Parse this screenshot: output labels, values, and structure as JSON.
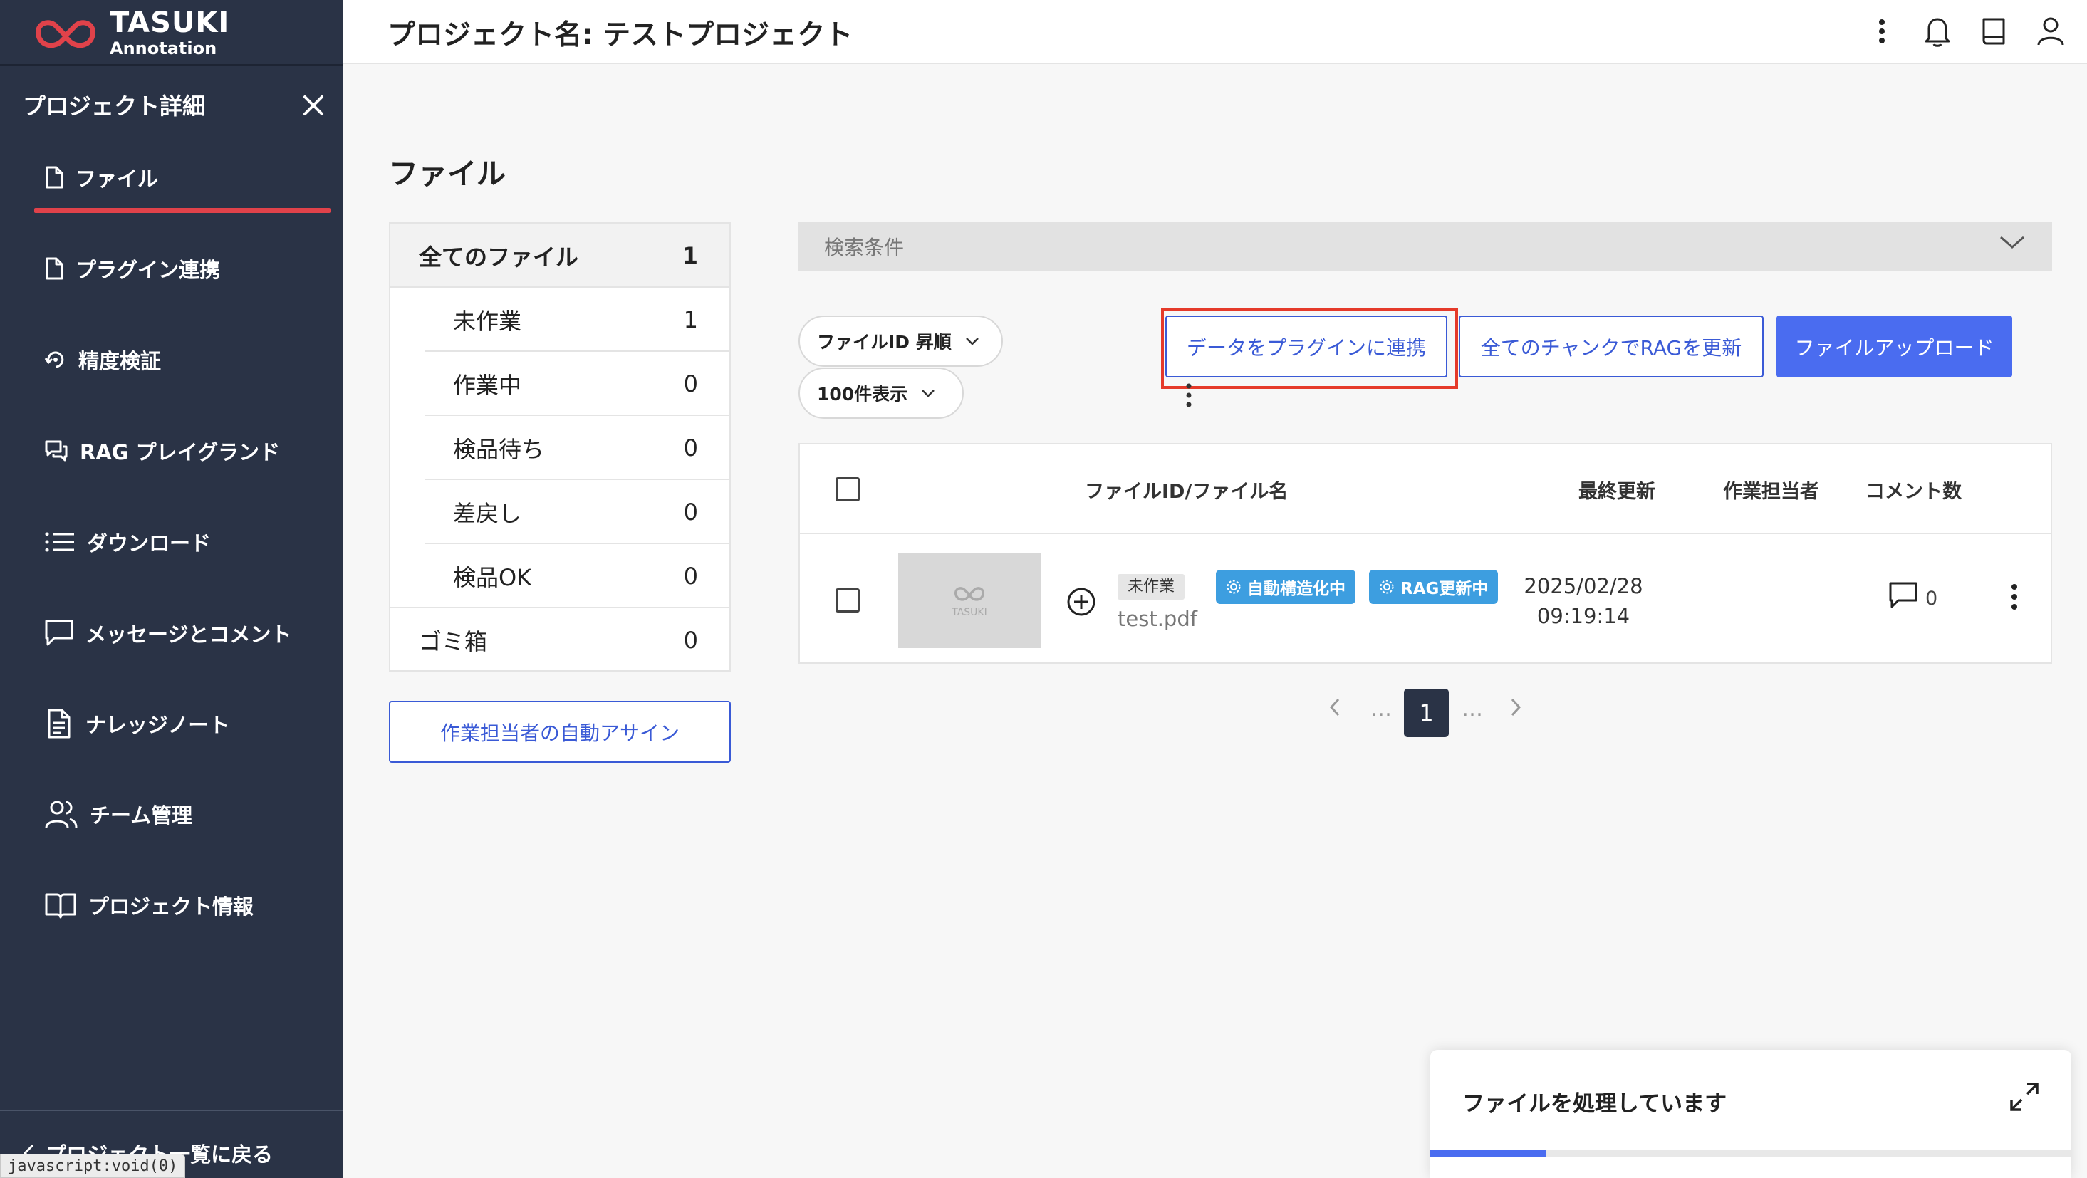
{
  "logo": {
    "line1": "TASUKI",
    "line2": "Annotation"
  },
  "header": {
    "title": "プロジェクト名: テストプロジェクト"
  },
  "sidebar": {
    "title": "プロジェクト詳細",
    "items": [
      {
        "label": "ファイル",
        "icon": "file-icon",
        "active": true
      },
      {
        "label": "プラグイン連携",
        "icon": "file-icon"
      },
      {
        "label": "精度検証",
        "icon": "accuracy-icon"
      },
      {
        "label": "RAG プレイグランド",
        "icon": "chat-icon"
      },
      {
        "label": "ダウンロード",
        "icon": "list-icon"
      },
      {
        "label": "メッセージとコメント",
        "icon": "message-icon"
      },
      {
        "label": "ナレッジノート",
        "icon": "document-icon"
      },
      {
        "label": "チーム管理",
        "icon": "team-icon"
      },
      {
        "label": "プロジェクト情報",
        "icon": "book-icon"
      }
    ],
    "back_label": "プロジェクト一覧に戻る",
    "status_url": "javascript:void(0)"
  },
  "main": {
    "heading": "ファイル",
    "filters": [
      {
        "label": "全てのファイル",
        "count": "1"
      },
      {
        "label": "未作業",
        "count": "1"
      },
      {
        "label": "作業中",
        "count": "0"
      },
      {
        "label": "検品待ち",
        "count": "0"
      },
      {
        "label": "差戻し",
        "count": "0"
      },
      {
        "label": "検品OK",
        "count": "0"
      },
      {
        "label": "ゴミ箱",
        "count": "0"
      }
    ],
    "assign_button": "作業担当者の自動アサイン",
    "search_label": "検索条件",
    "sort_select": "ファイルID 昇順",
    "page_size_select": "100件表示",
    "plugin_button": "データをプラグインに連携",
    "rag_button": "全てのチャンクでRAGを更新",
    "upload_button": "ファイルアップロード",
    "table": {
      "headers": {
        "file": "ファイルID/ファイル名",
        "updated": "最終更新",
        "assignee": "作業担当者",
        "comments": "コメント数"
      },
      "rows": [
        {
          "status": "未作業",
          "filename": "test.pdf",
          "tags": [
            "自動構造化中",
            "RAG更新中"
          ],
          "date": "2025/02/28",
          "time": "09:19:14",
          "comments": "0",
          "thumb_text": "TASUKI"
        }
      ]
    },
    "pagination": {
      "current": "1",
      "ellipsis": "…"
    }
  },
  "toast": {
    "title": "ファイルを処理しています",
    "progress": 0.18
  },
  "colors": {
    "sidebar": "#2a3346",
    "accent": "#4a6cf0",
    "active_underline": "#e0424a",
    "tag": "#3d9ee0",
    "highlight": "#e53a2a"
  }
}
